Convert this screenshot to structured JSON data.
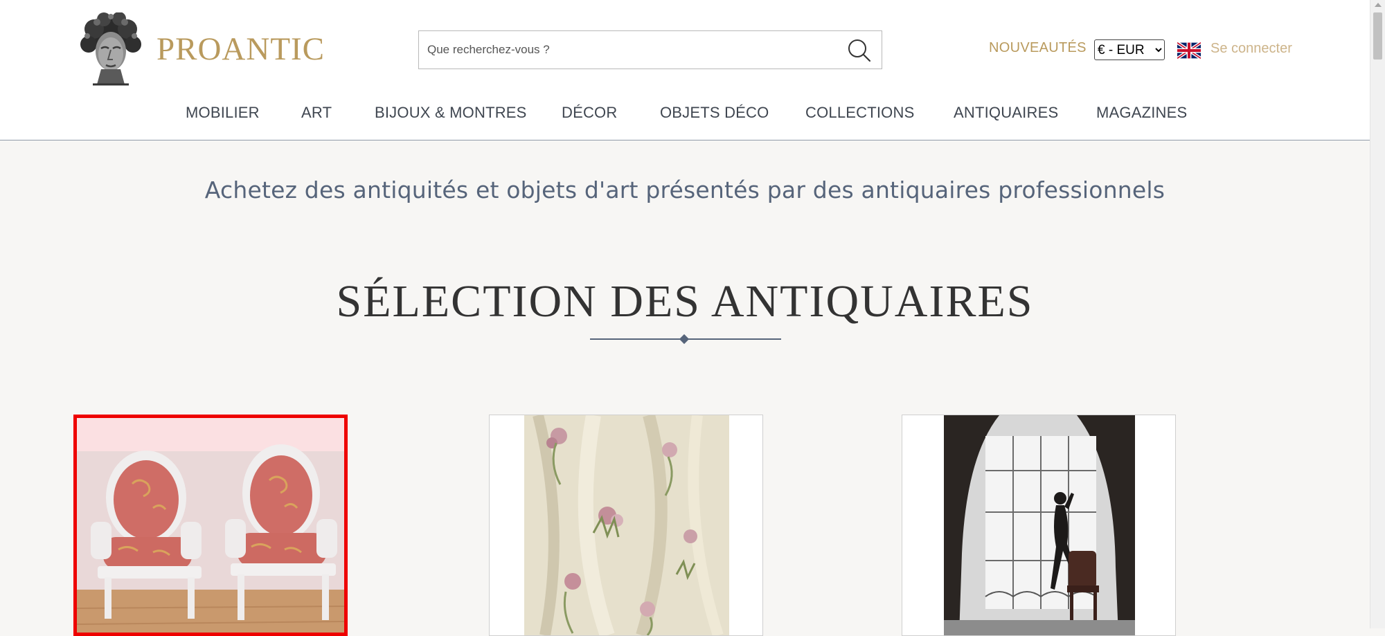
{
  "brand": {
    "name": "PROANTIC"
  },
  "search": {
    "placeholder": "Que recherchez-vous ?"
  },
  "header_links": {
    "new_label": "NOUVEAUTÉS",
    "currency_selected": "€ - EUR",
    "login_label": "Se connecter",
    "language_icon": "uk-flag-icon"
  },
  "nav": {
    "items": [
      {
        "label": "MOBILIER"
      },
      {
        "label": "ART"
      },
      {
        "label": "BIJOUX & MONTRES"
      },
      {
        "label": "DÉCOR"
      },
      {
        "label": "OBJETS DÉCO"
      },
      {
        "label": "COLLECTIONS"
      },
      {
        "label": "ANTIQUAIRES"
      },
      {
        "label": "MAGAZINES"
      }
    ]
  },
  "hero": {
    "tagline": "Achetez des antiquités et objets d'art présentés par des antiquaires professionnels"
  },
  "selection": {
    "title": "SÉLECTION DES ANTIQUAIRES",
    "cards": [
      {
        "image": "pair-of-red-armchairs",
        "selected": true
      },
      {
        "image": "floral-brocade-fabric",
        "selected": false
      },
      {
        "image": "silhouette-at-window-photograph",
        "selected": false
      }
    ]
  },
  "colors": {
    "gold": "#b99a5d",
    "slate": "#56647a",
    "selection_outline": "#ee0000",
    "page_background": "#f7f6f4"
  }
}
